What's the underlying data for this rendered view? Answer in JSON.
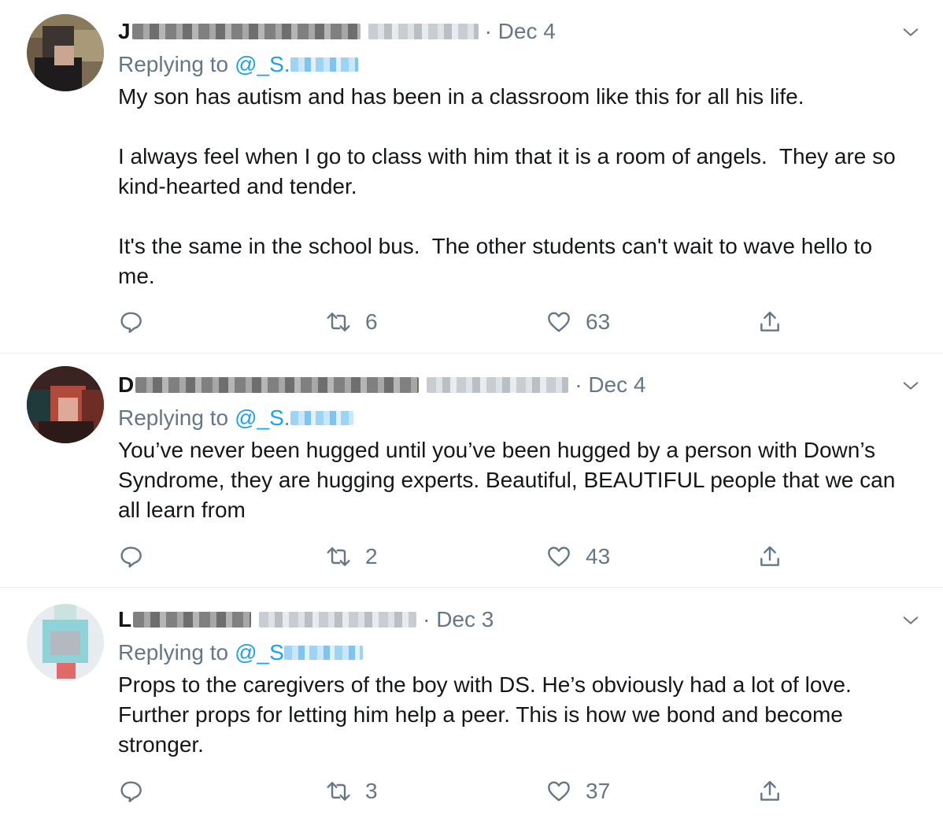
{
  "tweets": [
    {
      "name_initial": "J",
      "date": "· Dec 4",
      "reply_prefix": "Replying to",
      "reply_handle": "@_S.",
      "text": "My son has autism and has been in a classroom like this for all his life.\n\nI always feel when I go to class with him that it is a room of angels.  They are so kind-hearted and tender.\n\nIt's the same in the school bus.  The other students can't wait to wave hello to me.",
      "retweets": "6",
      "likes": "63"
    },
    {
      "name_initial": "D",
      "date": "· Dec 4",
      "reply_prefix": "Replying to",
      "reply_handle": "@_S.",
      "text": "You’ve never been hugged until you’ve been hugged by a person with Down’s Syndrome, they are hugging experts. Beautiful, BEAUTIFUL people that we can all learn from",
      "retweets": "2",
      "likes": "43"
    },
    {
      "name_initial": "L",
      "date": "· Dec 3",
      "reply_prefix": "Replying to",
      "reply_handle": "@_S",
      "text": "Props to the caregivers of the boy with DS. He’s obviously had a lot of love. Further props for letting him help a peer. This is how we bond and become stronger.",
      "retweets": "3",
      "likes": "37"
    }
  ],
  "icons": {
    "reply": "reply-icon",
    "retweet": "retweet-icon",
    "like": "heart-icon",
    "share": "share-icon",
    "menu": "chevron-down-icon"
  },
  "colors": {
    "text": "#14171a",
    "muted": "#657786",
    "link": "#1da1f2",
    "divider": "#e6ecf0"
  }
}
